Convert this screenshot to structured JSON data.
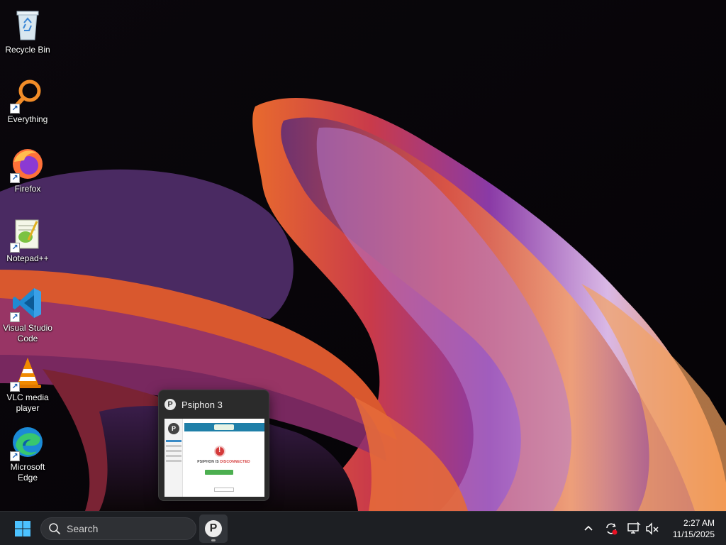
{
  "desktop": {
    "icons": [
      {
        "label": "Recycle Bin",
        "icon": "recycle-bin-icon",
        "shortcut": false
      },
      {
        "label": "Everything",
        "icon": "everything-search-icon",
        "shortcut": true
      },
      {
        "label": "Firefox",
        "icon": "firefox-icon",
        "shortcut": true
      },
      {
        "label": "Notepad++",
        "icon": "notepad-plus-plus-icon",
        "shortcut": true
      },
      {
        "label": "Visual Studio Code",
        "icon": "vscode-icon",
        "shortcut": true
      },
      {
        "label": "VLC media player",
        "icon": "vlc-icon",
        "shortcut": true
      },
      {
        "label": "Microsoft Edge",
        "icon": "edge-icon",
        "shortcut": true
      }
    ]
  },
  "preview": {
    "title": "Psiphon 3",
    "thumbnail": {
      "status_prefix": "PSIPHON IS ",
      "status_value": "DISCONNECTED",
      "status_color": "#d43a3a"
    }
  },
  "taskbar": {
    "search_placeholder": "Search",
    "pinned_app": {
      "name": "Psiphon 3",
      "icon": "psiphon-icon",
      "glyph": "P"
    },
    "tray": {
      "chevron": "show-hidden-icons",
      "icons": [
        "sync-alert-icon",
        "network-icon",
        "volume-muted-icon"
      ]
    },
    "clock": {
      "time": "2:27 AM",
      "date": "11/15/2025"
    }
  },
  "colors": {
    "taskbar_bg": "#1d1f23",
    "windows_blue": "#4cc2ff",
    "accent_orange": "#f26b3a",
    "accent_purple": "#7b3fa0"
  }
}
